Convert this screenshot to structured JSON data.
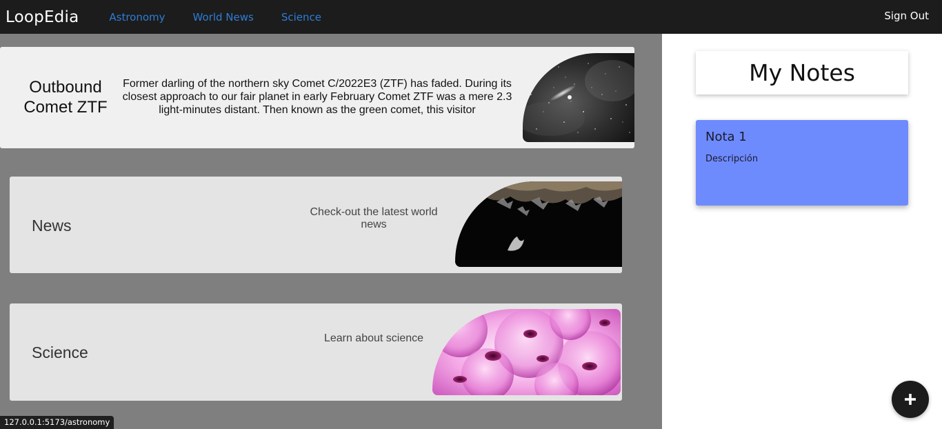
{
  "navbar": {
    "brand": "LoopEdia",
    "links": [
      "Astronomy",
      "World News",
      "Science"
    ],
    "sign_out": "Sign Out"
  },
  "featured": {
    "title": "Outbound Comet ZTF",
    "description": "Former darling of the northern sky Comet C/2022E3 (ZTF) has faded. During its closest approach to our fair planet in early February Comet ZTF was a mere 2.3 light-minutes distant. Then known as the green comet, this visitor"
  },
  "sections": {
    "news": {
      "title": "News",
      "description": "Check-out the latest world news"
    },
    "science": {
      "title": "Science",
      "description": "Learn about science"
    }
  },
  "sidebar": {
    "header": "My Notes",
    "notes": [
      {
        "title": "Nota 1",
        "description": "Descripción"
      }
    ],
    "add_icon": "plus-icon"
  },
  "status_url": "127.0.0.1:5173/astronomy",
  "colors": {
    "navbar": "#1c1c1c",
    "link": "#2f7dd6",
    "note_card": "#6e8bfd",
    "main_bg": "#7f7f7f"
  }
}
